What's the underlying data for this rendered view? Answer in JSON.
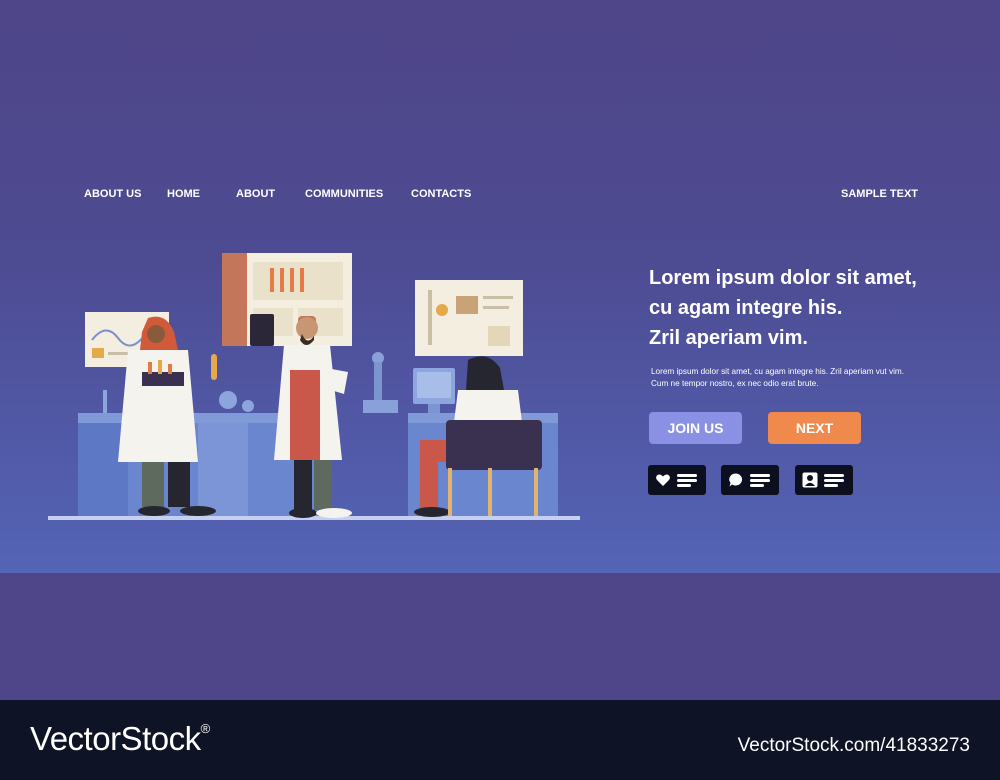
{
  "nav": {
    "items": [
      "ABOUT US",
      "HOME",
      "ABOUT",
      "COMMUNITIES",
      "CONTACTS"
    ],
    "right_label": "SAMPLE TEXT"
  },
  "hero": {
    "headline": [
      "Lorem ipsum dolor sit amet,",
      "cu agam integre his.",
      "Zril aperiam vim."
    ],
    "body": [
      "Lorem ipsum dolor sit amet, cu agam integre his.  Zril aperiam vut vim.",
      "Cum ne tempor nostro,  ex nec odio erat brute."
    ],
    "buttons": {
      "join": "JOIN US",
      "next": "NEXT"
    },
    "social_icons": [
      "heart-icon",
      "chat-icon",
      "profile-icon"
    ]
  },
  "footer": {
    "brand": "VectorStock",
    "registered": "®",
    "id": "VectorStock.com/41833273"
  },
  "colors": {
    "background": "#4f4589",
    "hero_bottom": "#5464b6",
    "join_button": "#8a90e4",
    "next_button": "#f08a4c",
    "footer": "#0e1325"
  }
}
